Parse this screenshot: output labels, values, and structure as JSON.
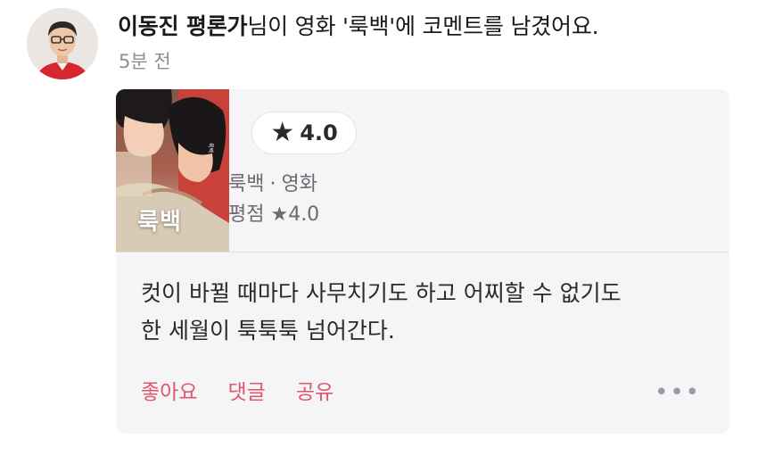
{
  "header": {
    "user_name": "이동진 평론가",
    "action_text": "님이 영화 '룩백'에 코멘트를 남겼어요.",
    "time_ago": "5분 전"
  },
  "avatar": {
    "icon": "user-avatar"
  },
  "card": {
    "poster_title": "룩백",
    "rating_chip": {
      "star_icon": "★",
      "value": "4.0"
    },
    "movie_title": "룩백",
    "separator": "·",
    "category": "영화",
    "rating_line": "평점 ★4.0",
    "comment_lines": [
      "컷이 바뀔 때마다 사무치기도 하고 어찌할 수 없기도",
      "한 세월이 툭툭툭 넘어간다."
    ],
    "actions": {
      "like": "좋아요",
      "comment": "댓글",
      "share": "공유"
    },
    "more_icon": "•••",
    "accent_color": "#e2556b"
  }
}
